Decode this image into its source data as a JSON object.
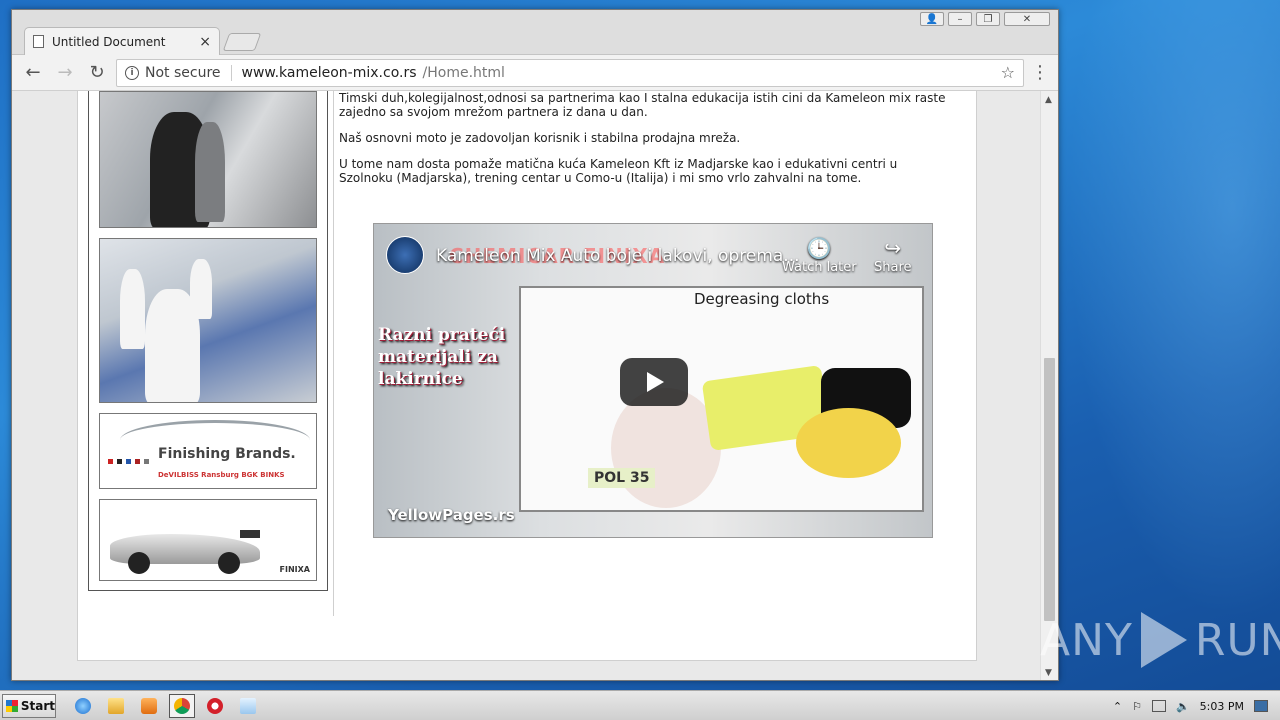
{
  "browser": {
    "tab_title": "Untitled Document",
    "tab_close": "×",
    "security_label": "Not secure",
    "url_host": "www.kameleon-mix.co.rs",
    "url_path": "/Home.html"
  },
  "content": {
    "paragraph1": "Timski duh,kolegijalnost,odnosi sa partnerima kao I stalna edukacija istih cini da Kameleon mix raste zajedno sa svojom mrežom partnera iz dana u dan.",
    "paragraph2": "Naš  osnovni moto je zadovoljan korisnik i stabilna prodajna  mreža.",
    "paragraph3": "U tome nam dosta pomaže matična kuća Kameleon Kft iz Madjarske kao i edukativni centri u Szolnoku (Madjarska), trening centar u Como-u (Italija) i mi smo vrlo zahvalni na tome."
  },
  "video": {
    "title": "Kameleon Mix Auto boje i lakovi, oprema...",
    "watch_later": "Watch later",
    "share": "Share",
    "overlay_watermark": "CHEMICAR FINIXA",
    "left_text": "Razni prateći materijali za lakirnice",
    "degreasing": "Degreasing cloths",
    "pol": "POL 35",
    "yellowpages": "YellowPages.rs"
  },
  "sidebar": {
    "finishing_brands": "Finishing Brands.",
    "brand_row": "DeVILBISS  Ransburg  BGK  BINKS",
    "finixa": "FINIXA"
  },
  "taskbar": {
    "start_label": "Start",
    "clock": "5:03 PM"
  },
  "watermark": {
    "left": "ANY",
    "right": "RUN"
  }
}
